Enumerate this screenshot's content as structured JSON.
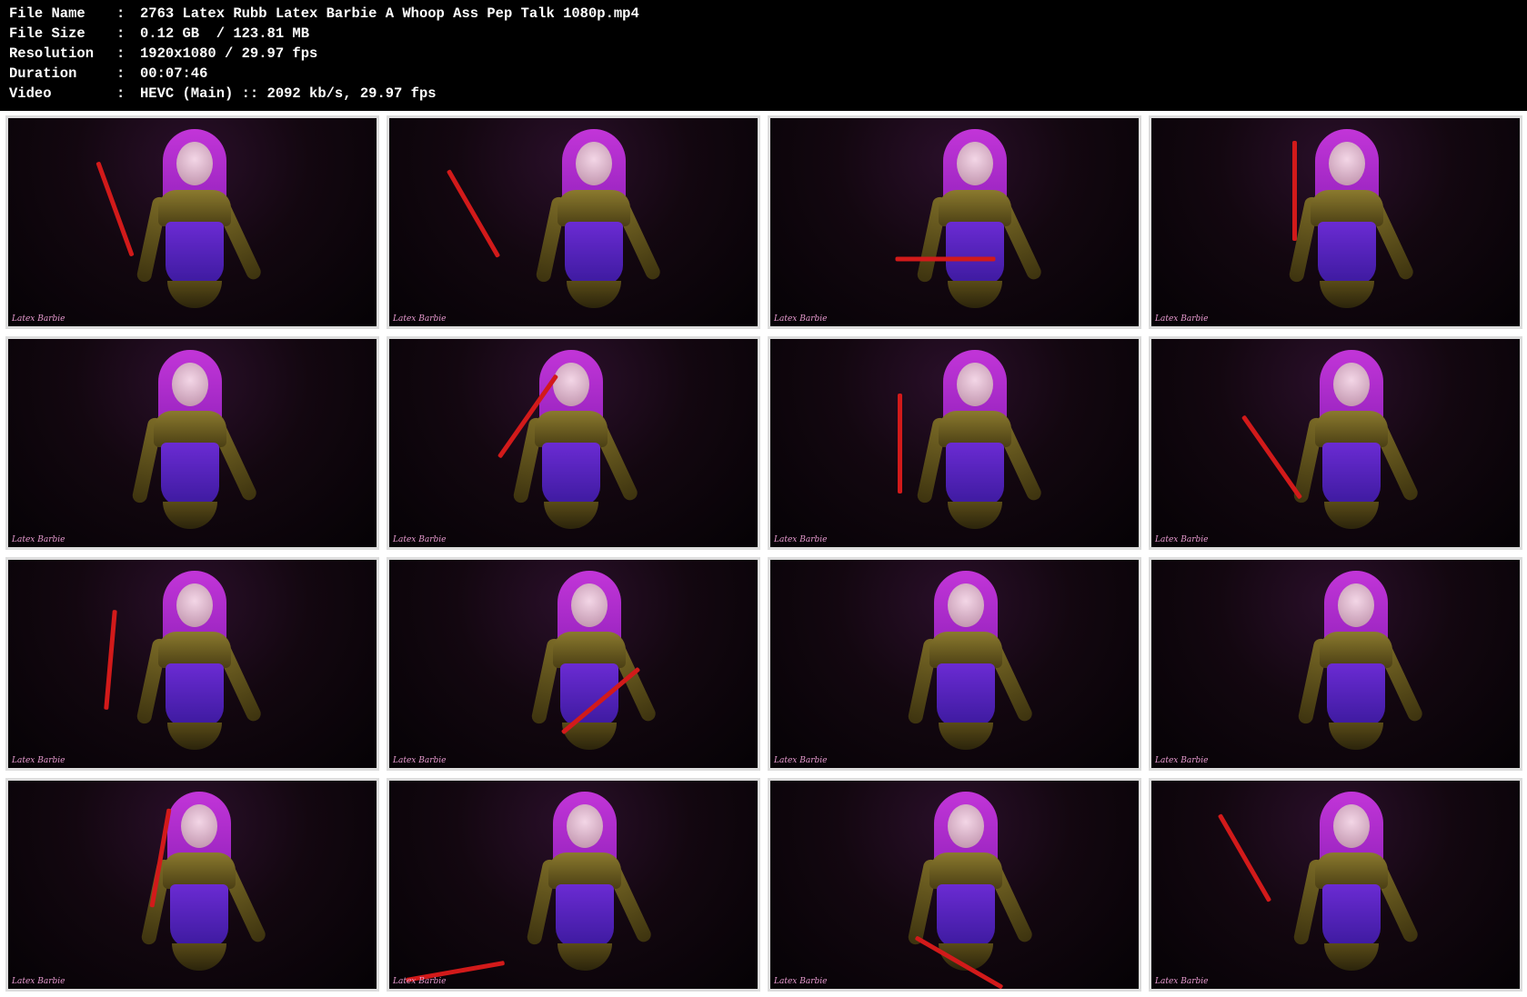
{
  "info": [
    {
      "label": "File Name",
      "sep": ":",
      "value": "2763 Latex Rubb Latex Barbie A Whoop Ass Pep Talk 1080p.mp4"
    },
    {
      "label": "File Size",
      "sep": ":",
      "value": "0.12 GB  / 123.81 MB"
    },
    {
      "label": "Resolution",
      "sep": ":",
      "value": "1920x1080 / 29.97 fps"
    },
    {
      "label": "Duration",
      "sep": ":",
      "value": "00:07:46"
    },
    {
      "label": "Video",
      "sep": ":",
      "value": "HEVC (Main) :: 2092 kb/s, 29.97 fps"
    }
  ],
  "thumbnails": [
    {
      "logo": "Latex Barbie"
    },
    {
      "logo": "Latex Barbie"
    },
    {
      "logo": "Latex Barbie"
    },
    {
      "logo": "Latex Barbie"
    },
    {
      "logo": "Latex Barbie"
    },
    {
      "logo": "Latex Barbie"
    },
    {
      "logo": "Latex Barbie"
    },
    {
      "logo": "Latex Barbie"
    },
    {
      "logo": "Latex Barbie"
    },
    {
      "logo": "Latex Barbie"
    },
    {
      "logo": "Latex Barbie"
    },
    {
      "logo": "Latex Barbie"
    },
    {
      "logo": "Latex Barbie"
    },
    {
      "logo": "Latex Barbie"
    },
    {
      "logo": "Latex Barbie"
    },
    {
      "logo": "Latex Barbie"
    }
  ],
  "colors": {
    "background": "#000000",
    "grid_background": "#ffffff",
    "hair": "#c235d8",
    "corset": "#6b2bd3",
    "gold_latex": "#8b7a2e",
    "cane": "#d21a1a"
  }
}
